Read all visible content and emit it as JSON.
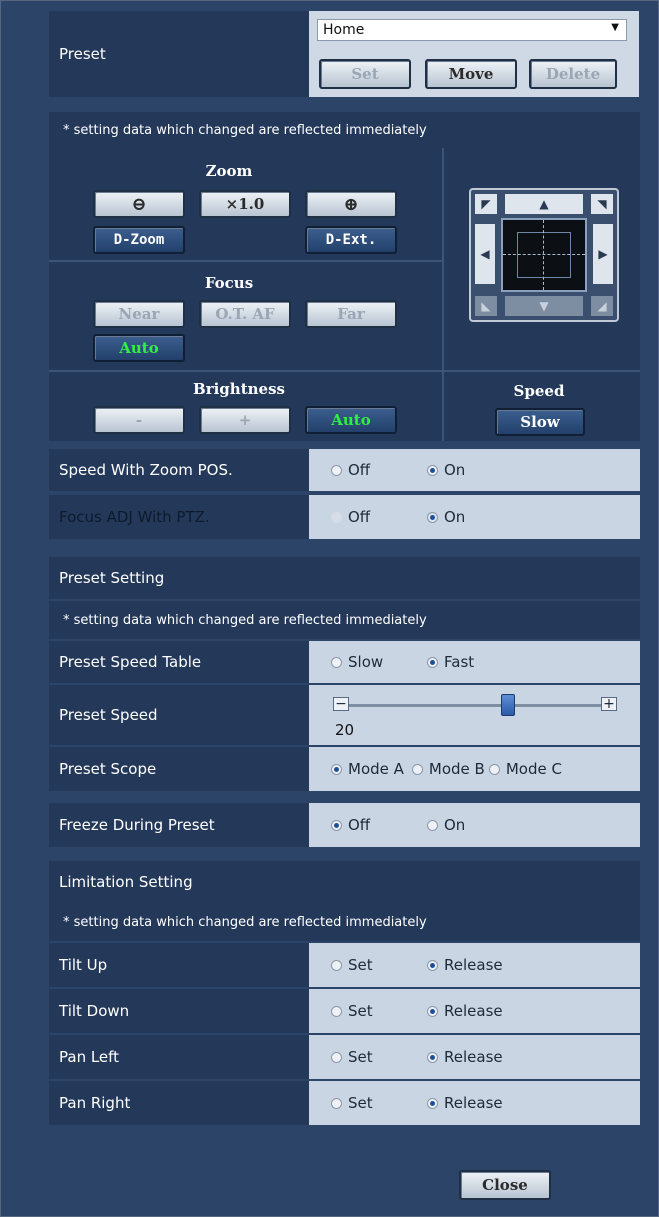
{
  "preset": {
    "label": "Preset",
    "selected": "Home",
    "set_label": "Set",
    "move_label": "Move",
    "delete_label": "Delete"
  },
  "note_text": "* setting data which changed are reflected immediately",
  "zoom": {
    "title": "Zoom",
    "zoom_out_icon": "⊖",
    "ratio_label": "×1.0",
    "zoom_in_icon": "⊕",
    "dzoom_label": "D-Zoom",
    "dext_label": "D-Ext."
  },
  "focus": {
    "title": "Focus",
    "near_label": "Near",
    "otaf_label": "O.T. AF",
    "far_label": "Far",
    "auto_label": "Auto"
  },
  "brightness": {
    "title": "Brightness",
    "minus_label": "-",
    "plus_label": "+",
    "auto_label": "Auto"
  },
  "speed": {
    "title": "Speed",
    "value_label": "Slow"
  },
  "speed_with_zoom": {
    "label": "Speed With Zoom POS.",
    "opt_off": "Off",
    "opt_on": "On",
    "selected": "On"
  },
  "focus_adj": {
    "label": "Focus ADJ With PTZ.",
    "opt_off": "Off",
    "opt_on": "On",
    "selected": "On"
  },
  "preset_setting": {
    "header": "Preset Setting",
    "speed_table_label": "Preset Speed Table",
    "speed_table_opts": [
      "Slow",
      "Fast"
    ],
    "speed_table_selected": "Fast",
    "speed_label": "Preset Speed",
    "speed_value": "20",
    "speed_fraction": 0.64,
    "scope_label": "Preset Scope",
    "scope_opts": [
      "Mode A",
      "Mode B",
      "Mode C"
    ],
    "scope_selected": "Mode A"
  },
  "freeze": {
    "label": "Freeze During Preset",
    "opt_off": "Off",
    "opt_on": "On",
    "selected": "Off"
  },
  "limitation": {
    "header": "Limitation Setting",
    "rows": [
      {
        "label": "Tilt Up",
        "opt_set": "Set",
        "opt_release": "Release",
        "selected": "Release"
      },
      {
        "label": "Tilt Down",
        "opt_set": "Set",
        "opt_release": "Release",
        "selected": "Release"
      },
      {
        "label": "Pan Left",
        "opt_set": "Set",
        "opt_release": "Release",
        "selected": "Release"
      },
      {
        "label": "Pan Right",
        "opt_set": "Set",
        "opt_release": "Release",
        "selected": "Release"
      }
    ]
  },
  "close_label": "Close",
  "colors": {
    "background": "#2b4468",
    "dark_row": "#24395a",
    "light_cell": "#c9d5e3",
    "auto_green": "#2ef043"
  }
}
